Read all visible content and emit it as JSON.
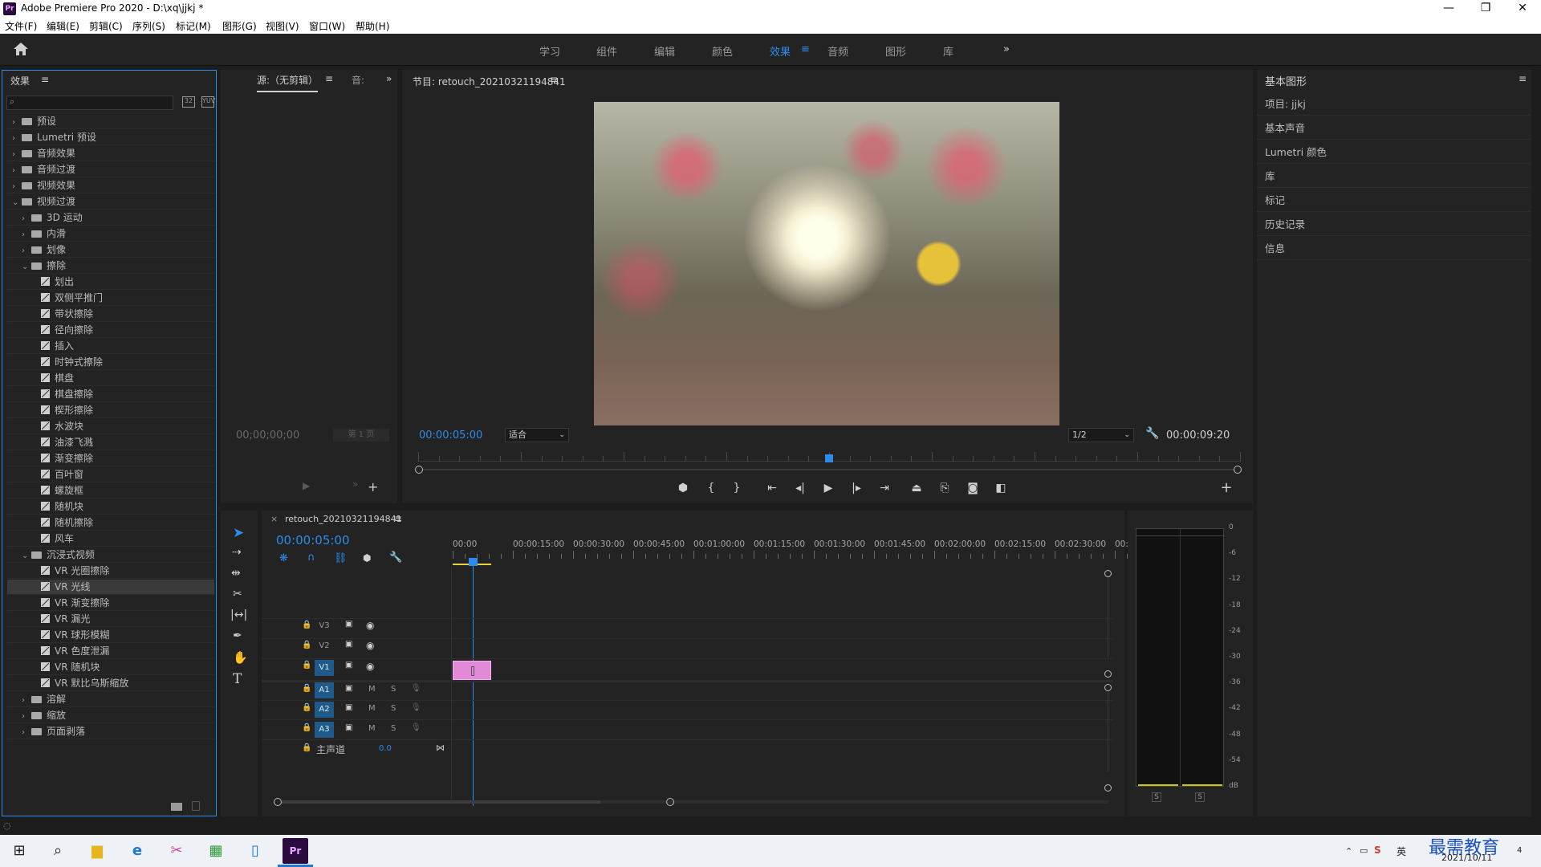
{
  "app": {
    "title": "Adobe Premiere Pro 2020 - D:\\xq\\jjkj *",
    "logo": "Pr",
    "window_controls": [
      "—",
      "❐",
      "✕"
    ]
  },
  "menu": [
    "文件(F)",
    "编辑(E)",
    "剪辑(C)",
    "序列(S)",
    "标记(M)",
    "图形(G)",
    "视图(V)",
    "窗口(W)",
    "帮助(H)"
  ],
  "workspaces": {
    "items": [
      "学习",
      "组件",
      "编辑",
      "颜色",
      "效果",
      "音频",
      "图形",
      "库"
    ],
    "active": "效果",
    "more": "»"
  },
  "effects_panel": {
    "title": "效果",
    "menu_glyph": "≡",
    "search_placeholder": "",
    "tree": [
      {
        "level": 0,
        "type": "folder",
        "label": "预设",
        "expanded": false
      },
      {
        "level": 0,
        "type": "folder",
        "label": "Lumetri 预设",
        "expanded": false
      },
      {
        "level": 0,
        "type": "folder",
        "label": "音频效果",
        "expanded": false
      },
      {
        "level": 0,
        "type": "folder",
        "label": "音频过渡",
        "expanded": false
      },
      {
        "level": 0,
        "type": "folder",
        "label": "视频效果",
        "expanded": false
      },
      {
        "level": 0,
        "type": "folder",
        "label": "视频过渡",
        "expanded": true
      },
      {
        "level": 1,
        "type": "folder",
        "label": "3D 运动",
        "expanded": false
      },
      {
        "level": 1,
        "type": "folder",
        "label": "内滑",
        "expanded": false
      },
      {
        "level": 1,
        "type": "folder",
        "label": "划像",
        "expanded": false
      },
      {
        "level": 1,
        "type": "folder",
        "label": "擦除",
        "expanded": true
      },
      {
        "level": 2,
        "type": "fx",
        "label": "划出"
      },
      {
        "level": 2,
        "type": "fx",
        "label": "双侧平推门"
      },
      {
        "level": 2,
        "type": "fx",
        "label": "带状擦除"
      },
      {
        "level": 2,
        "type": "fx",
        "label": "径向擦除"
      },
      {
        "level": 2,
        "type": "fx",
        "label": "插入"
      },
      {
        "level": 2,
        "type": "fx",
        "label": "时钟式擦除"
      },
      {
        "level": 2,
        "type": "fx",
        "label": "棋盘"
      },
      {
        "level": 2,
        "type": "fx",
        "label": "棋盘擦除"
      },
      {
        "level": 2,
        "type": "fx",
        "label": "楔形擦除"
      },
      {
        "level": 2,
        "type": "fx",
        "label": "水波块"
      },
      {
        "level": 2,
        "type": "fx",
        "label": "油漆飞溅"
      },
      {
        "level": 2,
        "type": "fx",
        "label": "渐变擦除"
      },
      {
        "level": 2,
        "type": "fx",
        "label": "百叶窗"
      },
      {
        "level": 2,
        "type": "fx",
        "label": "螺旋框"
      },
      {
        "level": 2,
        "type": "fx",
        "label": "随机块"
      },
      {
        "level": 2,
        "type": "fx",
        "label": "随机擦除"
      },
      {
        "level": 2,
        "type": "fx",
        "label": "风车"
      },
      {
        "level": 1,
        "type": "folder",
        "label": "沉浸式视频",
        "expanded": true
      },
      {
        "level": 2,
        "type": "fx",
        "label": "VR 光圈擦除"
      },
      {
        "level": 2,
        "type": "fx",
        "label": "VR 光线",
        "selected": true
      },
      {
        "level": 2,
        "type": "fx",
        "label": "VR 渐变擦除"
      },
      {
        "level": 2,
        "type": "fx",
        "label": "VR 漏光"
      },
      {
        "level": 2,
        "type": "fx",
        "label": "VR 球形模糊"
      },
      {
        "level": 2,
        "type": "fx",
        "label": "VR 色度泄漏"
      },
      {
        "level": 2,
        "type": "fx",
        "label": "VR 随机块"
      },
      {
        "level": 2,
        "type": "fx",
        "label": "VR 默比乌斯缩放"
      },
      {
        "level": 1,
        "type": "folder",
        "label": "溶解",
        "expanded": false
      },
      {
        "level": 1,
        "type": "folder",
        "label": "缩放",
        "expanded": false
      },
      {
        "level": 1,
        "type": "folder",
        "label": "页面剥落",
        "expanded": false
      }
    ]
  },
  "source_panel": {
    "tab_label": "源:（无剪辑）",
    "tab2_label": "音:",
    "more": "»",
    "timecode": "00;00;00;00",
    "page": "第 1 页"
  },
  "program_panel": {
    "title": "节目: retouch_20210321194841",
    "timecode_current": "00:00:05:00",
    "fit": "适合",
    "resolution": "1/2",
    "timecode_duration": "00:00:09:20",
    "playhead_fraction": 0.5,
    "controls": [
      "marker",
      "in",
      "out",
      "go-to-in",
      "step-back",
      "play",
      "step-forward",
      "go-to-out",
      "lift",
      "extract",
      "export-frame",
      "compare"
    ],
    "add": "+"
  },
  "timeline": {
    "close": "×",
    "sequence_name": "retouch_20210321194841",
    "timecode": "00:00:05:00",
    "ruler": [
      "00:00",
      "00:00:15:00",
      "00:00:30:00",
      "00:00:45:00",
      "00:01:00:00",
      "00:01:15:00",
      "00:01:30:00",
      "00:01:45:00",
      "00:02:00:00",
      "00:02:15:00",
      "00:02:30:00",
      "00:"
    ],
    "video_tracks": [
      "V3",
      "V2",
      "V1"
    ],
    "audio_tracks": [
      "A1",
      "A2",
      "A3"
    ],
    "mix_label": "主声道",
    "mix_value": "0.0",
    "audio_buttons": [
      "M",
      "S"
    ]
  },
  "meter": {
    "labels": [
      "0",
      "-6",
      "-12",
      "-18",
      "-24",
      "-30",
      "-36",
      "-42",
      "-48",
      "-54",
      "dB"
    ],
    "solo": [
      "S",
      "S"
    ]
  },
  "right_panel": {
    "title": "基本图形",
    "items": [
      "项目: jjkj",
      "基本声音",
      "Lumetri 颜色",
      "库",
      "标记",
      "历史记录",
      "信息"
    ]
  },
  "taskbar": {
    "clock_date": "2021/10/11",
    "ime": "英",
    "notifications": "4",
    "watermark": "最需教育"
  },
  "colors": {
    "accent": "#2d8ceb",
    "panel": "#232323",
    "clip": "#e28ad8",
    "track_on": "#1f5a8a"
  }
}
